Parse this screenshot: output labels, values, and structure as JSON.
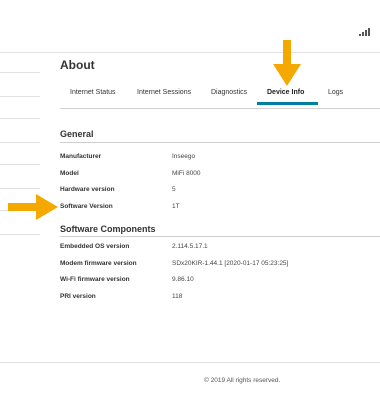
{
  "page": {
    "title": "About"
  },
  "tabs": [
    {
      "label": "Internet Status"
    },
    {
      "label": "Internet Sessions"
    },
    {
      "label": "Diagnostics"
    },
    {
      "label": "Device Info",
      "active": true
    },
    {
      "label": "Logs"
    }
  ],
  "general": {
    "title": "General",
    "rows": [
      {
        "label": "Manufacturer",
        "value": "Inseego"
      },
      {
        "label": "Model",
        "value": "MiFi 8000"
      },
      {
        "label": "Hardware version",
        "value": "5"
      },
      {
        "label": "Software Version",
        "value": "1T"
      }
    ]
  },
  "software": {
    "title": "Software Components",
    "rows": [
      {
        "label": "Embedded OS version",
        "value": "2.114.5.17.1"
      },
      {
        "label": "Modem firmware version",
        "value": "SDx20KIR-1.44.1 [2020-01-17 05:23:25]"
      },
      {
        "label": "Wi-Fi firmware version",
        "value": "9.86.10"
      },
      {
        "label": "PRI version",
        "value": "118"
      }
    ]
  },
  "footer": {
    "copyright": "© 2019 All rights reserved."
  },
  "colors": {
    "accent": "#007da3",
    "callout": "#f5a800"
  },
  "icons": {
    "status": "signal-icon",
    "callouts": "arrow-icon"
  }
}
